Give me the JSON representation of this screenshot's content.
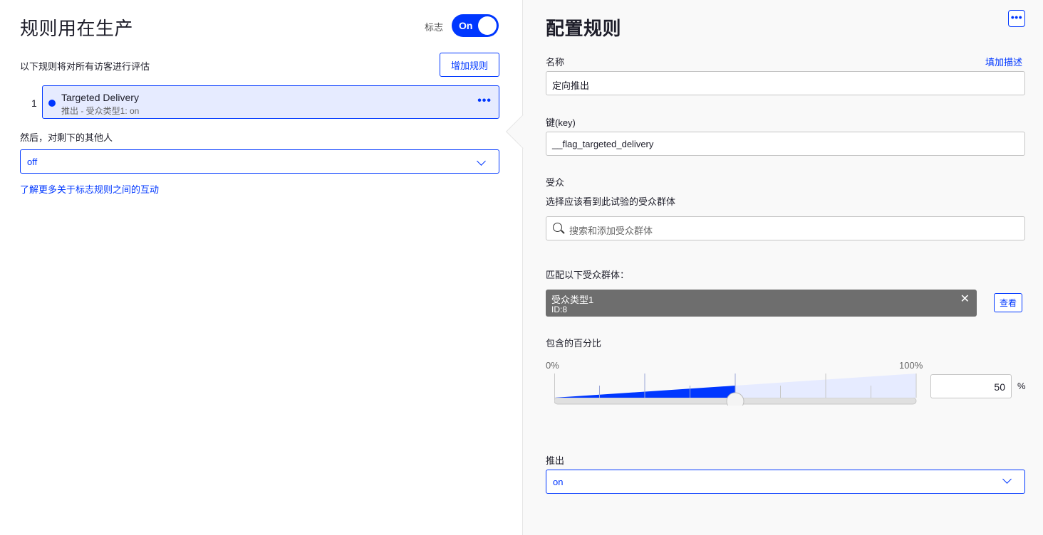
{
  "left": {
    "title": "规则用在生产",
    "flag_label": "标志",
    "toggle": {
      "label": "On",
      "state": "on"
    },
    "description": "以下规则将对所有访客进行评估",
    "add_rule_button": "增加规则",
    "rules": [
      {
        "number": "1",
        "name": "Targeted Delivery",
        "subtitle": "推出 - 受众类型1: on",
        "more": "•••"
      }
    ],
    "then_label": "然后，对剩下的其他人",
    "fallback_select": {
      "value": "off"
    },
    "learn_more_link": "了解更多关于标志规则之间的互动"
  },
  "right": {
    "title": "配置规则",
    "more": "•••",
    "name_label": "名称",
    "add_description_link": "填加描述",
    "name_value": "定向推出",
    "key_label": "键(key)",
    "key_value": "__flag_targeted_delivery",
    "audience_label": "受众",
    "audience_hint": "选择应该看到此试验的受众群体",
    "audience_search_placeholder": "搜索和添加受众群体",
    "match_label": "匹配以下受众群体：",
    "audience_chip": {
      "name": "受众类型1",
      "id": "ID:8"
    },
    "view_button": "查看",
    "percent_label": "包含的百分比",
    "slider": {
      "min_label": "0%",
      "max_label": "100%",
      "value": 50,
      "ticks": 8
    },
    "percent_value": "50",
    "percent_sign": "%",
    "rollout_label": "推出",
    "rollout_select": {
      "value": "on"
    }
  },
  "colors": {
    "accent": "#0037ff",
    "chip_bg": "#6e6e6e",
    "panel_bg": "#f9f9f9"
  }
}
